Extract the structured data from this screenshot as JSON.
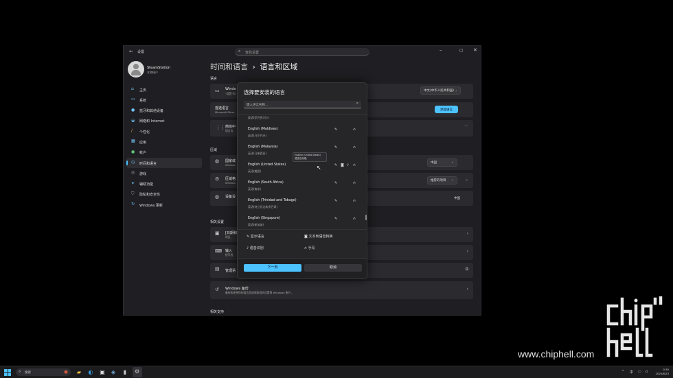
{
  "window": {
    "app_title": "设置",
    "search_placeholder": "查找设置",
    "user": {
      "name": "SteamStation",
      "type": "本地帐户"
    }
  },
  "nav": [
    {
      "label": "主页",
      "icon": "home-icon",
      "active": false
    },
    {
      "label": "系统",
      "icon": "monitor-icon",
      "active": false
    },
    {
      "label": "蓝牙和其他设备",
      "icon": "bluetooth-icon",
      "active": false
    },
    {
      "label": "网络和 Internet",
      "icon": "wifi-icon",
      "active": false
    },
    {
      "label": "个性化",
      "icon": "brush-icon",
      "active": false
    },
    {
      "label": "应用",
      "icon": "apps-icon",
      "active": false
    },
    {
      "label": "帐户",
      "icon": "person-icon",
      "active": false
    },
    {
      "label": "时间和语言",
      "icon": "globe-clock-icon",
      "active": true
    },
    {
      "label": "游戏",
      "icon": "gamepad-icon",
      "active": false
    },
    {
      "label": "辅助功能",
      "icon": "accessibility-icon",
      "active": false
    },
    {
      "label": "隐私和安全性",
      "icon": "shield-icon",
      "active": false
    },
    {
      "label": "Windows 更新",
      "icon": "update-icon",
      "active": false
    }
  ],
  "page": {
    "breadcrumb_parent": "时间和语言",
    "breadcrumb_sep": "›",
    "breadcrumb_current": "语言和区域",
    "section_language": "语言",
    "display_lang_title": "Windo",
    "display_lang_sub": "\"设置\"和",
    "display_lang_value": "中文(中华人民共和国)",
    "preferred_title": "首选语言",
    "preferred_sub": "Microsoft Store",
    "add_language_button": "添加语言",
    "lang_item_title": "简体中",
    "lang_item_sub": "语言包,",
    "section_region": "区域",
    "country_title": "国家或",
    "country_sub": "Window",
    "country_value": "中国",
    "format_title": "区域格",
    "format_sub": "Window",
    "format_value": "推荐的项目",
    "formatting_title": "设备设",
    "formatting_value": "中国",
    "section_related": "相关设置",
    "admin_title": "[日期和",
    "admin_sub": "时区、",
    "typing_title": "输入",
    "typing_sub": "拼写检",
    "manage_title": "管理语",
    "backup_title": "Windows 备份",
    "backup_sub": "备份和还原你的语言首选项和相关设置到 Windows 帐户。",
    "section_related_help": "相关支持"
  },
  "dialog": {
    "title": "选择要安装的语言",
    "search_placeholder": "键入语言名称...",
    "partial_item": "英语(伊巴西(马))",
    "languages": [
      {
        "name": "English (Maldives)",
        "sub": "英语(马尔代夫)",
        "features": [
          "display-language-icon",
          "handwriting-icon"
        ]
      },
      {
        "name": "English (Malaysia)",
        "sub": "英语(马来西亚)",
        "features": [
          "display-language-icon",
          "handwriting-icon"
        ]
      },
      {
        "name": "English (United States)",
        "sub": "英语(美国)",
        "features": [
          "display-language-icon",
          "text-to-speech-icon",
          "speech-recognition-icon",
          "handwriting-icon"
        ]
      },
      {
        "name": "English (South Africa)",
        "sub": "英语(南非)",
        "features": [
          "display-language-icon",
          "handwriting-icon"
        ]
      },
      {
        "name": "English (Trinidad and Tobago)",
        "sub": "英语(特立尼达和多巴哥)",
        "features": [
          "display-language-icon",
          "handwriting-icon"
        ]
      },
      {
        "name": "English (Singapore)",
        "sub": "英语(新加坡)",
        "features": [
          "display-language-icon",
          "handwriting-icon"
        ]
      }
    ],
    "tooltip_line1": "English (United States)",
    "tooltip_line2": "语言包功能",
    "legend": {
      "display_language": "显示语言",
      "text_to_speech": "文本到语音转换",
      "speech_recognition": "语音识别",
      "handwriting": "手写"
    },
    "next_button": "下一页",
    "cancel_button": "取消"
  },
  "watermark": {
    "url": "www.chiphell.com"
  },
  "taskbar": {
    "search_placeholder": "搜索",
    "tray_chevron": "^",
    "ime": "中",
    "time": "0:30",
    "date": "2025/6/23"
  }
}
